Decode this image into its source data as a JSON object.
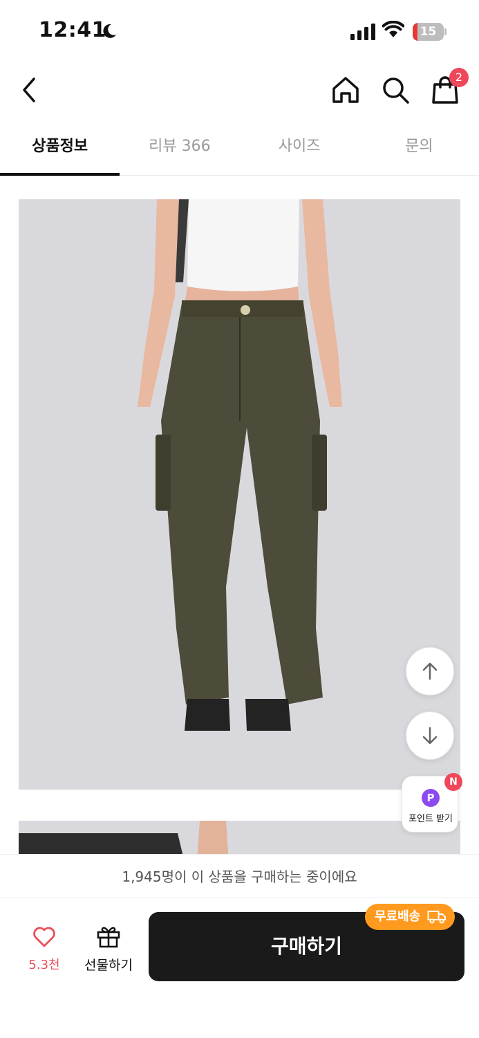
{
  "status_bar": {
    "time": "12:41",
    "battery_level": "15",
    "battery_fraction": 0.15
  },
  "nav": {
    "cart_count": "2"
  },
  "tabs": [
    {
      "label": "상품정보",
      "active": true
    },
    {
      "label": "리뷰 366",
      "active": false
    },
    {
      "label": "사이즈",
      "active": false
    },
    {
      "label": "문의",
      "active": false
    }
  ],
  "floating": {
    "point_badge": "P",
    "point_label": "포인트 받기",
    "new_badge": "N"
  },
  "bottom": {
    "buyers_text": "1,945명이 이 상품을 구매하는 중이에요",
    "like_count": "5.3천",
    "gift_label": "선물하기",
    "buy_label": "구매하기",
    "free_shipping_label": "무료배송"
  },
  "colors": {
    "accent_red": "#f0485b",
    "point_purple": "#8b4bf0",
    "shipping_orange": "#ff9a1f",
    "buy_button": "#1a1a1a"
  }
}
